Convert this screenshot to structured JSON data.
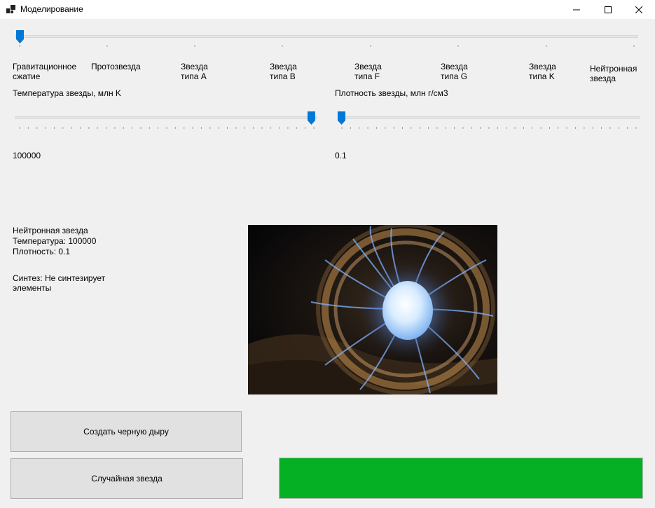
{
  "window": {
    "title": "Моделирование"
  },
  "stages": {
    "items": [
      {
        "label": "Гравитационное\nсжатие"
      },
      {
        "label": "Протозвезда"
      },
      {
        "label": "Звезда\nтипа A"
      },
      {
        "label": "Звезда\nтипа B"
      },
      {
        "label": "Звезда\nтипа F"
      },
      {
        "label": "Звезда\nтипа G"
      },
      {
        "label": "Звезда\nтипа K"
      },
      {
        "label": "Нейтронная\nзвезда"
      }
    ],
    "slider_position": 0
  },
  "temperature": {
    "label": "Температура звезды, млн K",
    "value": "100000",
    "slider_fraction": 0.99
  },
  "density": {
    "label": "Плотность звезды, млн г/см3",
    "value": "0.1",
    "slider_fraction": 0.0
  },
  "info": {
    "name": "Нейтронная звезда",
    "temperature": "Температура: 100000",
    "density": "Плотность: 0.1",
    "synthesis": "Синтез: Не синтезирует\nэлементы"
  },
  "buttons": {
    "black_hole": "Создать черную дыру",
    "random_star": "Случайная звезда"
  },
  "progress": {
    "value_percent": 100,
    "color": "#06b025"
  },
  "colors": {
    "accent": "#0078d7"
  }
}
